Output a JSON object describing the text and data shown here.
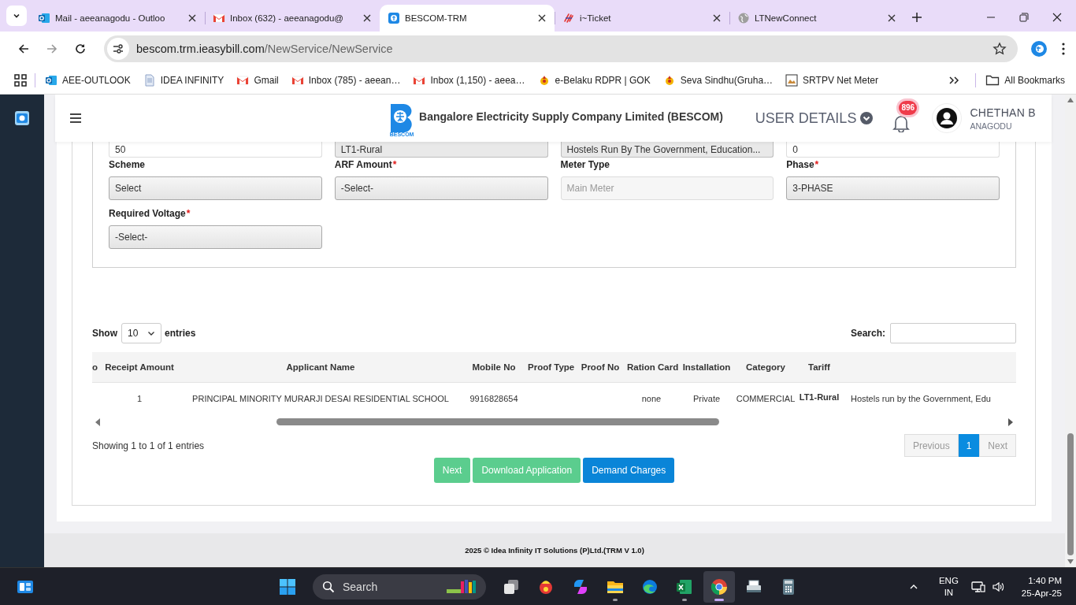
{
  "browser": {
    "tabs": [
      {
        "kind": "outlook",
        "title": "Mail - aeeanagodu - Outloo",
        "selected": false
      },
      {
        "kind": "gmail",
        "title": "Inbox (632) - aeeanagodu@",
        "selected": false
      },
      {
        "kind": "bescom",
        "title": "BESCOM-TRM",
        "selected": true
      },
      {
        "kind": "ticket",
        "title": "i~Ticket",
        "selected": false
      },
      {
        "kind": "globe",
        "title": "LTNewConnect",
        "selected": false
      }
    ],
    "address": {
      "host": "bescom.trm.ieasybill.com",
      "path": "/NewService/NewService"
    },
    "bookmarks": [
      {
        "kind": "outlook",
        "label": "AEE-OUTLOOK"
      },
      {
        "kind": "document",
        "label": "IDEA INFINITY"
      },
      {
        "kind": "gmail",
        "label": "Gmail"
      },
      {
        "kind": "gmail",
        "label": "Inbox (785) - aeean…"
      },
      {
        "kind": "gmail",
        "label": "Inbox (1,150) - aeea…"
      },
      {
        "kind": "emblem",
        "label": "e-Belaku RDPR | GOK"
      },
      {
        "kind": "emblem",
        "label": "Seva Sindhu(Gruha…"
      },
      {
        "kind": "image",
        "label": "SRTPV Net Meter"
      }
    ],
    "all_bookmarks": "All Bookmarks"
  },
  "header": {
    "logo_caption": "BESCOM",
    "title": "Bangalore Electricity Supply Company Limited (BESCOM)",
    "user_menu": "USER DETAILS",
    "notification_count": "896",
    "user": {
      "name": "CHETHAN B",
      "subtitle": "ANAGODU"
    }
  },
  "form": {
    "partial_row": [
      {
        "kind": "input",
        "value": "50"
      },
      {
        "kind": "readonly",
        "value": "LT1-Rural"
      },
      {
        "kind": "readonly",
        "value": "Hostels Run By The Government, Education..."
      },
      {
        "kind": "input",
        "value": "0"
      }
    ],
    "fields": [
      {
        "label": "Scheme",
        "kind": "select",
        "value": "Select"
      },
      {
        "label": "ARF Amount",
        "required_mark": "*",
        "kind": "select",
        "value": "-Select-"
      },
      {
        "label": "Meter Type",
        "kind": "readonly",
        "placeholder": "Main Meter"
      },
      {
        "label": "Phase",
        "required_mark": "*",
        "kind": "select",
        "value": "3-PHASE"
      },
      {
        "label": "Required Voltage",
        "required_mark": "*",
        "kind": "select",
        "value": "-Select-"
      }
    ]
  },
  "table": {
    "show_label": "Show",
    "length": "10",
    "entries_label": "entries",
    "search_label": "Search:",
    "columns": [
      "o",
      "Receipt Amount",
      "Applicant Name",
      "Mobile No",
      "Proof Type",
      "Proof No",
      "Ration Card",
      "Installation",
      "Category",
      "Tariff"
    ],
    "rows": [
      {
        "cells": [
          null,
          "1",
          "PRINCIPAL MINORITY MURARJI DESAI RESIDENTIAL SCHOOL",
          "9916828654",
          null,
          null,
          "none",
          "Private",
          "COMMERCIAL",
          {
            "text": "LT1-Rural",
            "bold": true
          },
          "Hostels run by the Government, Edu"
        ]
      }
    ],
    "info": "Showing 1 to 1 of 1 entries",
    "pagination": [
      {
        "label": "Previous",
        "kind": "nav",
        "disabled": true,
        "selected": false
      },
      {
        "label": "1",
        "kind": "page",
        "selected": true
      },
      {
        "label": "Next",
        "kind": "nav",
        "disabled": true,
        "selected": false
      }
    ]
  },
  "actions": [
    {
      "label": "Next",
      "kind": "success",
      "disabled": true
    },
    {
      "label": "Download Application",
      "kind": "success",
      "disabled": true
    },
    {
      "label": "Demand Charges",
      "kind": "primary",
      "disabled": false
    }
  ],
  "footer": "2025 © Idea Infinity IT Solutions (P)Ltd.(TRM V 1.0)",
  "taskbar": {
    "search": "Search",
    "apps": [
      {
        "kind": "task-view",
        "running": false,
        "selected": false
      },
      {
        "kind": "character",
        "running": false,
        "selected": false
      },
      {
        "kind": "copilot",
        "running": false,
        "selected": false
      },
      {
        "kind": "explorer",
        "running": true,
        "selected": false
      },
      {
        "kind": "edge",
        "running": false,
        "selected": false
      },
      {
        "kind": "excel",
        "running": true,
        "selected": false
      },
      {
        "kind": "chrome",
        "running": true,
        "selected": true
      },
      {
        "kind": "scanner",
        "running": false,
        "selected": false
      },
      {
        "kind": "calculator",
        "running": false,
        "selected": false
      }
    ],
    "language": "ENG",
    "region": "IN",
    "time": "1:40 PM",
    "date": "25-Apr-25"
  }
}
